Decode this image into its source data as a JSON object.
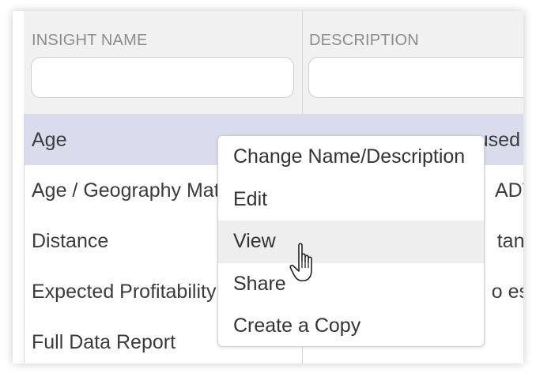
{
  "table": {
    "columns": [
      {
        "header": "INSIGHT NAME",
        "filter_value": ""
      },
      {
        "header": "DESCRIPTION",
        "filter_value": ""
      }
    ],
    "rows": [
      {
        "name": "Age",
        "description": "used",
        "selected": true
      },
      {
        "name": "Age / Geography Mat",
        "description": "ADT",
        "selected": false
      },
      {
        "name": "Distance",
        "description": "tanc",
        "selected": false
      },
      {
        "name": "Expected Profitability",
        "description": "o est",
        "selected": false
      },
      {
        "name": "Full Data Report",
        "description": "",
        "selected": false
      }
    ]
  },
  "context_menu": {
    "items": [
      {
        "label": "Change Name/Description"
      },
      {
        "label": "Edit"
      },
      {
        "label": "View",
        "hovered": true
      },
      {
        "label": "Share"
      },
      {
        "label": "Create a Copy"
      }
    ]
  },
  "colors": {
    "selected_row": "#d8dced",
    "header_bg": "#f1f1f1",
    "menu_hover": "#eeeeee"
  },
  "cursor": {
    "icon": "hand-pointer-icon"
  }
}
